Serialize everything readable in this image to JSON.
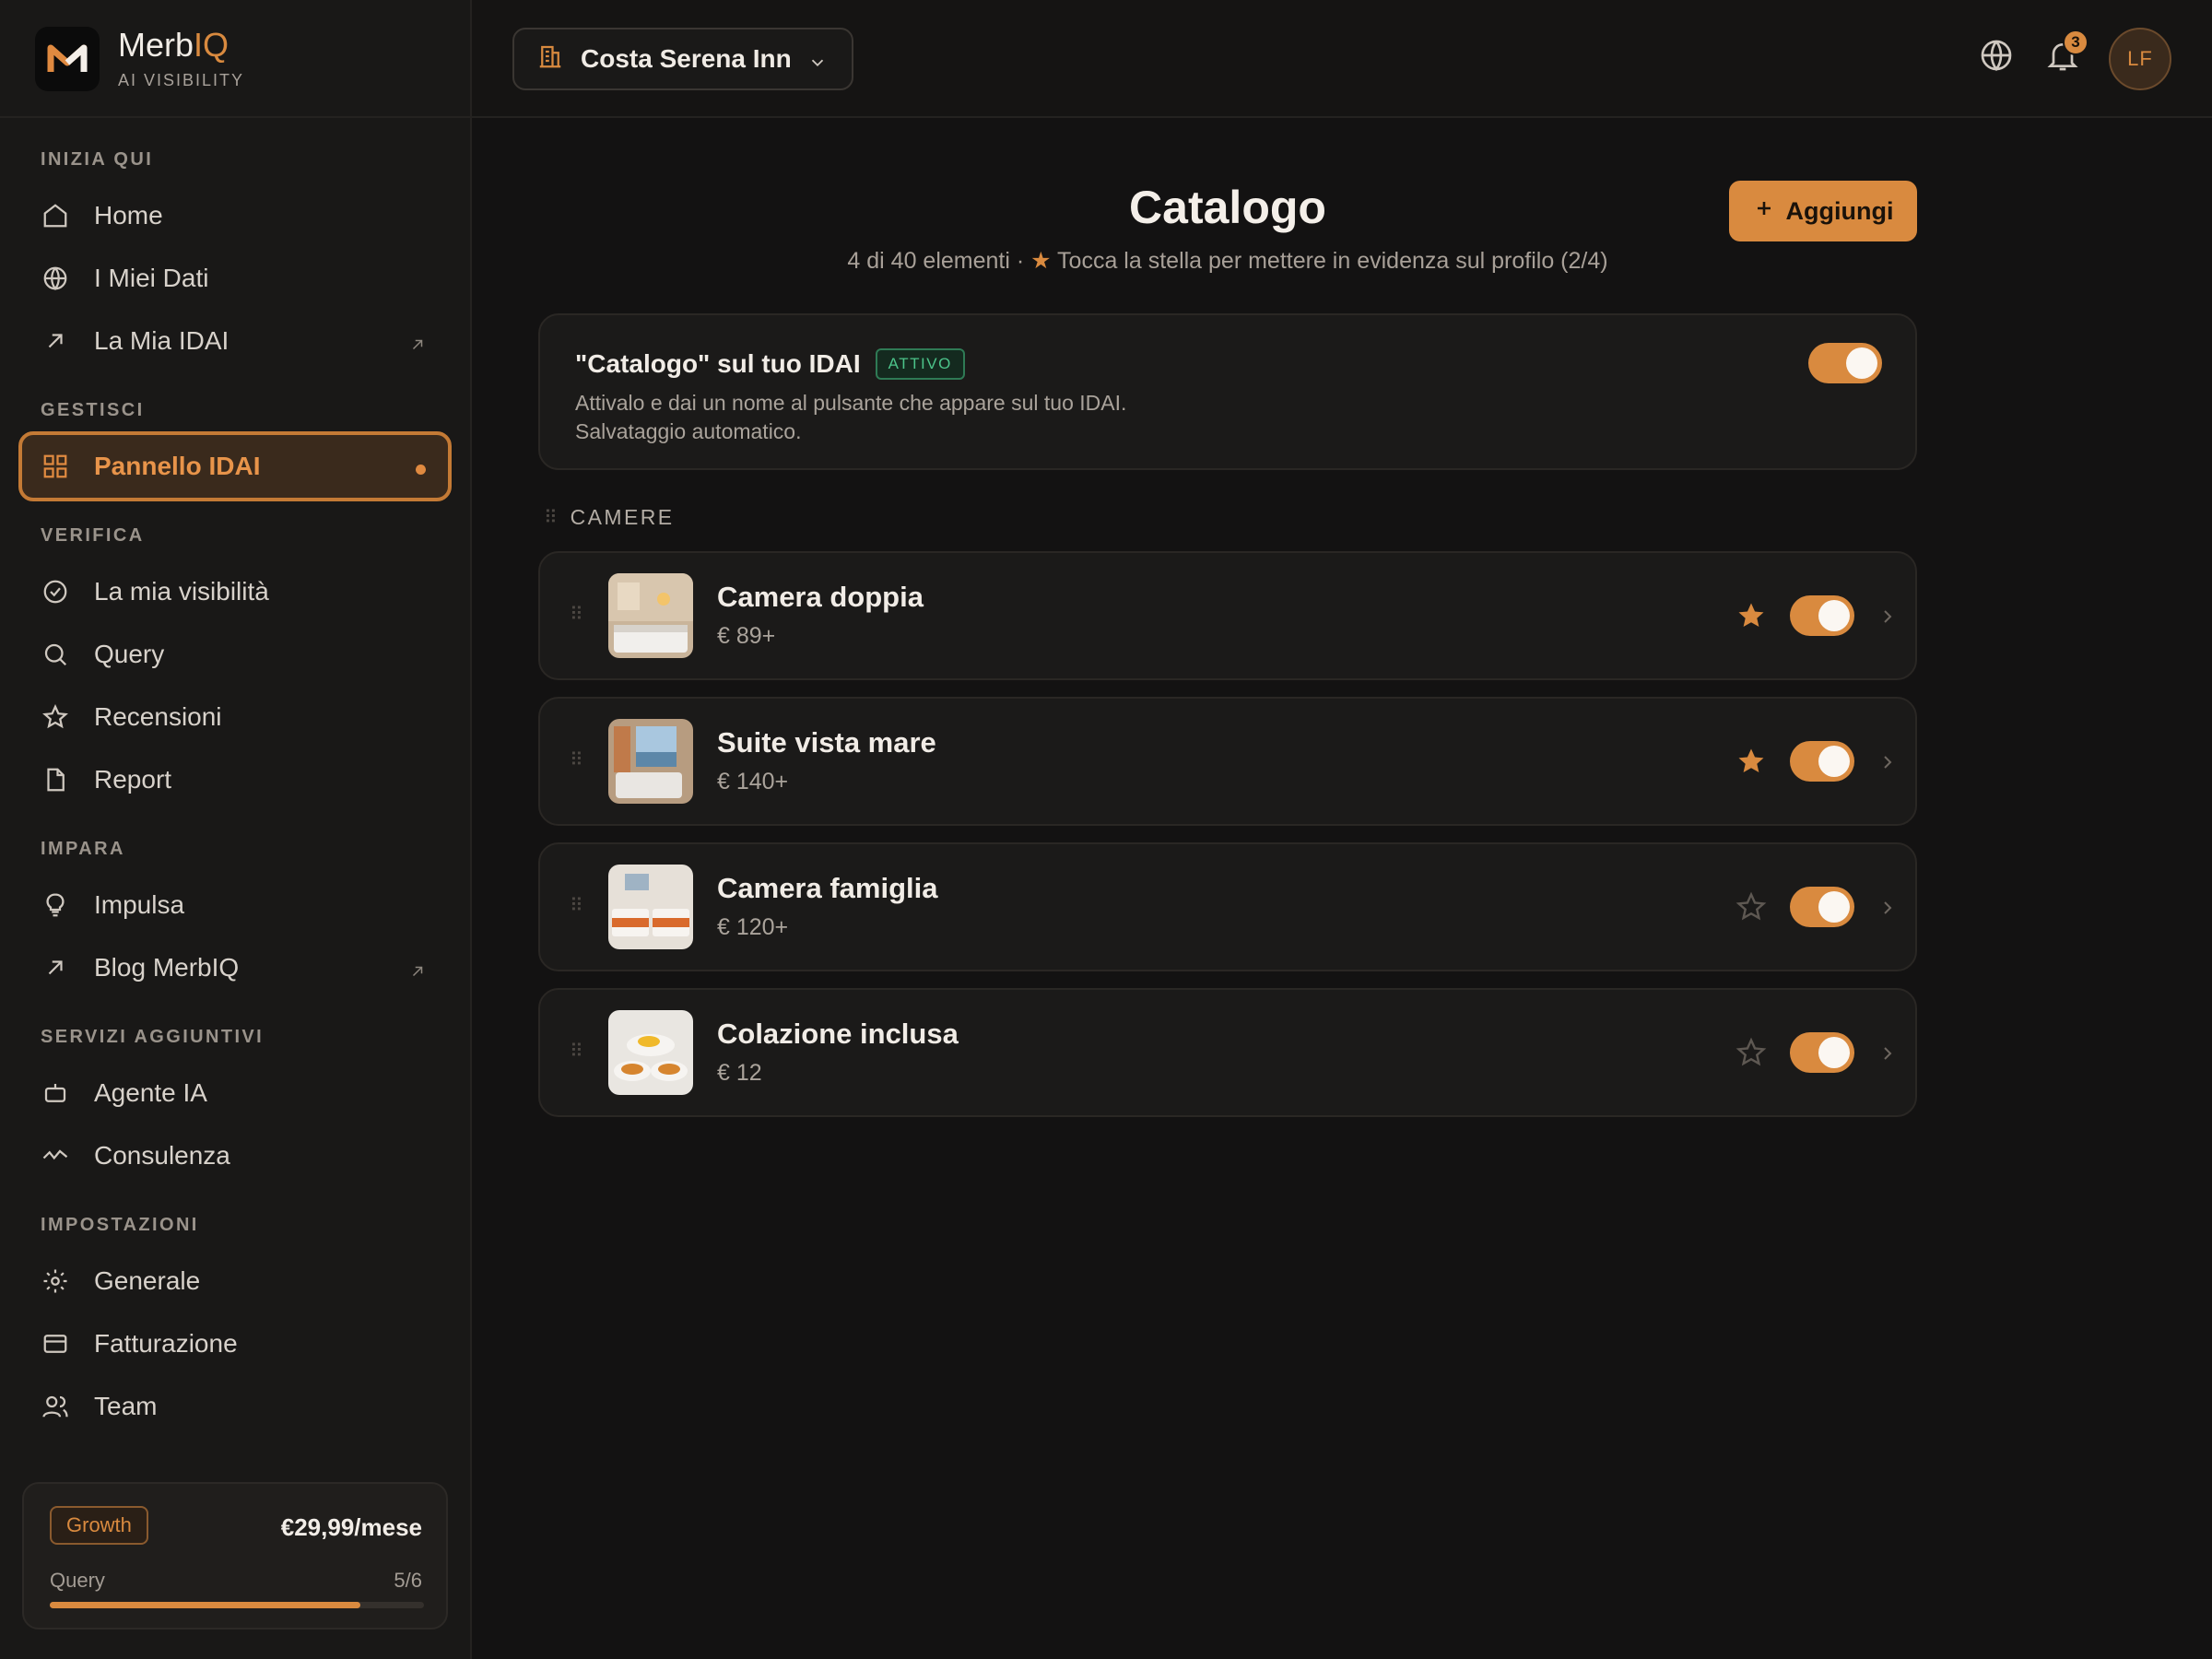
{
  "brand": {
    "name_a": "Merb",
    "name_b": "IQ",
    "subtitle": "AI VISIBILITY"
  },
  "sidebar": {
    "sections": [
      {
        "label": "INIZIA QUI"
      },
      {
        "label": "GESTISCI"
      },
      {
        "label": "VERIFICA"
      },
      {
        "label": "IMPARA"
      },
      {
        "label": "SERVIZI AGGIUNTIVI"
      },
      {
        "label": "IMPOSTAZIONI"
      }
    ],
    "items": [
      {
        "label": "Home",
        "icon": "home-icon"
      },
      {
        "label": "I Miei Dati",
        "icon": "globe-icon"
      },
      {
        "label": "La Mia IDAI",
        "icon": "arrow-up-right-icon"
      },
      {
        "label": "Pannello IDAI",
        "icon": "grid-icon",
        "active": true
      },
      {
        "label": "La mia visibilità",
        "icon": "gauge-icon"
      },
      {
        "label": "Query",
        "icon": "search-icon"
      },
      {
        "label": "Recensioni",
        "icon": "star-icon"
      },
      {
        "label": "Report",
        "icon": "file-icon"
      },
      {
        "label": "Impulsa",
        "icon": "lightbulb-icon"
      },
      {
        "label": "Blog MerbIQ",
        "icon": "arrow-up-right-icon"
      },
      {
        "label": "Agente IA",
        "icon": "robot-icon"
      },
      {
        "label": "Consulenza",
        "icon": "activity-icon"
      },
      {
        "label": "Generale",
        "icon": "gear-icon"
      },
      {
        "label": "Fatturazione",
        "icon": "credit-card-icon"
      },
      {
        "label": "Team",
        "icon": "users-icon"
      }
    ]
  },
  "plan": {
    "name": "Growth",
    "price": "€29,99/mese",
    "usage_label": "Query",
    "usage_value": "5/6",
    "usage_fraction": 0.83
  },
  "topbar": {
    "hotel": "Costa Serena Inn",
    "notifications": "3",
    "avatar_initials": "LF"
  },
  "main": {
    "title": "Catalogo",
    "subtitle_a": "4 di 40 elementi · ",
    "subtitle_star": "★",
    "subtitle_b": " Tocca la stella per mettere in evidenza sul profilo (2/4)",
    "add_button": "Aggiungi",
    "feature": {
      "title": "\"Catalogo\" sul tuo IDAI",
      "badge": "ATTIVO",
      "desc_line1": "Attivalo e dai un nome al pulsante che appare sul tuo IDAI.",
      "desc_line2": "Salvataggio automatico.",
      "enabled": true
    },
    "section": "CAMERE",
    "items": [
      {
        "name": "Camera doppia",
        "price": "€ 89+",
        "featured": true,
        "enabled": true
      },
      {
        "name": "Suite vista mare",
        "price": "€ 140+",
        "featured": true,
        "enabled": true
      },
      {
        "name": "Camera famiglia",
        "price": "€ 120+",
        "featured": false,
        "enabled": true
      },
      {
        "name": "Colazione inclusa",
        "price": "€ 12",
        "featured": false,
        "enabled": true
      }
    ]
  },
  "colors": {
    "accent": "#d98a3f",
    "background": "#131212",
    "success": "#4cc38a"
  }
}
